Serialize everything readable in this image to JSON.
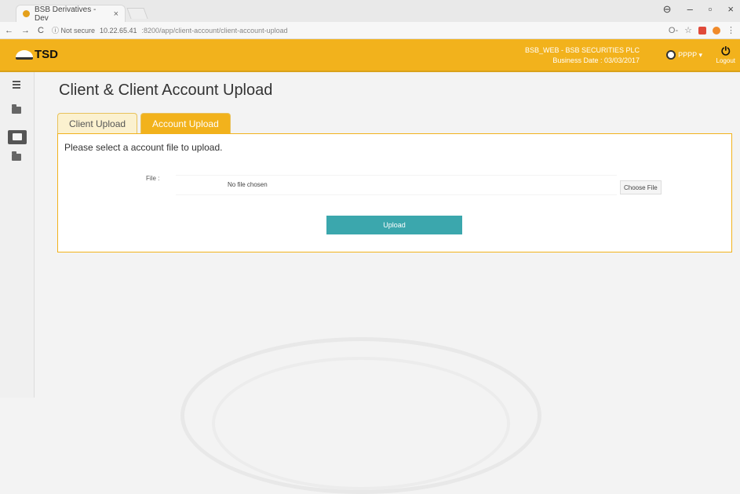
{
  "browser": {
    "tab_title": "BSB Derivatives - Dev",
    "tab_close": "×",
    "window_controls": {
      "account": "⊖",
      "minimize": "–",
      "restore": "▫",
      "close": "×"
    },
    "back": "←",
    "forward": "→",
    "reload": "C",
    "security": "ⓘ Not secure",
    "url_host": "10.22.65.41",
    "url_path": ":8200/app/client-account/client-account-upload",
    "ext_key": "O‑",
    "star": "☆",
    "menu": "⋮"
  },
  "header": {
    "logo_text": "TSD",
    "company": "BSB_WEB - BSB SECURITIES PLC",
    "business_date": "Business Date : 03/03/2017",
    "user_label": "PPPP ▾",
    "logout_label": "Logout",
    "logout_icon": "⏻",
    "accent_color": "#f2b21c"
  },
  "page": {
    "title": "Client & Client Account Upload",
    "tabs": [
      {
        "label": "Client Upload",
        "active": false
      },
      {
        "label": "Account Upload",
        "active": true
      }
    ],
    "message": "Please select a account file to upload.",
    "file_label": "File :",
    "file_status": "No file chosen",
    "choose_file": "Choose File",
    "upload_button": "Upload",
    "upload_color": "#3ba7ad"
  }
}
